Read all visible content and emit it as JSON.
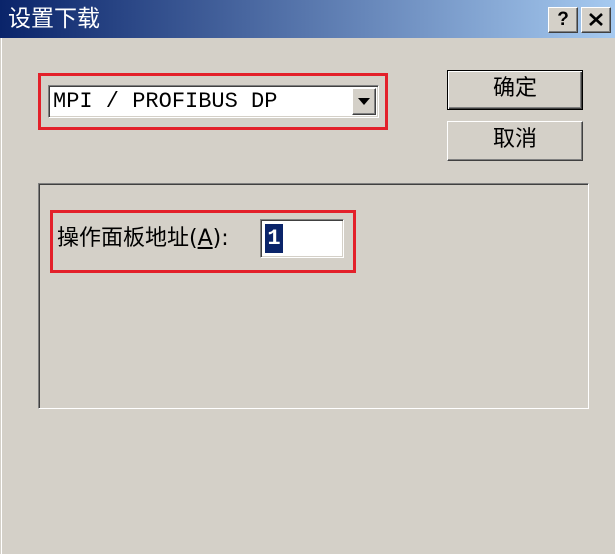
{
  "window": {
    "title": "设置下载",
    "help_label": "?",
    "close_icon": "close-icon"
  },
  "download_interface": {
    "selected_value": "MPI / PROFIBUS DP",
    "dropdown_icon": "chevron-down-icon"
  },
  "buttons": {
    "ok_label": "确定",
    "cancel_label": "取消"
  },
  "panel_address": {
    "label_before": "操作面板地址(",
    "label_accelerator": "A",
    "label_after": "):",
    "value": "1"
  },
  "colors": {
    "face": "#d4d0c8",
    "title_gradient_start": "#0a246a",
    "title_gradient_end": "#a6caf0",
    "title_text": "#ffffff",
    "highlight_box": "#e3202a",
    "selection": "#0a246a"
  }
}
